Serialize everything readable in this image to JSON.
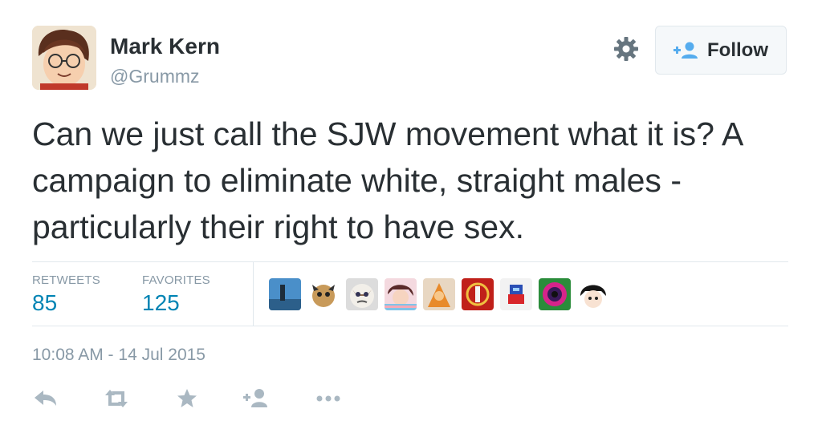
{
  "author": {
    "name": "Mark Kern",
    "handle": "@Grummz"
  },
  "follow_button": {
    "label": "Follow",
    "icon": "follow-plus-person-icon"
  },
  "settings_icon": "gear-icon",
  "tweet": {
    "text": "Can we just call the SJW movement what it is? A campaign to eliminate white, straight males - particularly their right to have sex."
  },
  "stats": {
    "retweets_label": "RETWEETS",
    "retweets_value": "85",
    "favorites_label": "FAVORITES",
    "favorites_value": "125"
  },
  "favorited_by_count_shown": 9,
  "timestamp": "10:08 AM - 14 Jul 2015",
  "actions": [
    "reply-icon",
    "retweet-icon",
    "favorite-icon",
    "follow-icon",
    "more-icon"
  ],
  "colors": {
    "link_blue": "#0084b4",
    "muted_text": "#8899a6",
    "text": "#292f33",
    "icon_gray": "#aab8c2",
    "border": "#e1e8ed"
  }
}
